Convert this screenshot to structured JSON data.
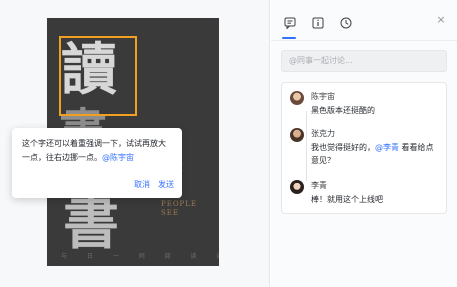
{
  "poster": {
    "char_top": "讀",
    "char_mid": "書",
    "char_bottom": "書",
    "gold_line1": "阿",
    "gold_line2": "之大",
    "people_line1": "PEOPLE",
    "people_line2": "SEE",
    "footer": "与 日 一 同 阅 读 自 一 书"
  },
  "popup": {
    "text": "这个字还可以着重强调一下，试试再放大一点，往右边挪一点。",
    "mention": "@陈宇宙",
    "cancel_label": "取消",
    "send_label": "发送"
  },
  "panel": {
    "tabs": [
      "comment-icon",
      "info-icon",
      "history-icon"
    ],
    "close_glyph": "×",
    "search_placeholder": "@同事一起讨论..."
  },
  "comments": [
    {
      "name": "陈宇宙",
      "body": "黑色版本还挺酷的",
      "avatar_color": "#b88c6e"
    },
    {
      "name": "张克力",
      "body_prefix": "我也觉得挺好的，",
      "mention": "@李青",
      "body_suffix": " 看看给点意见？",
      "avatar_color": "#7a5a48"
    },
    {
      "name": "李青",
      "body": "棒！就用这个上线吧",
      "avatar_color": "#c99a84"
    }
  ],
  "colors": {
    "accent": "#3370ff",
    "selection": "#f0a020",
    "poster_bg": "#3a3a3a"
  }
}
